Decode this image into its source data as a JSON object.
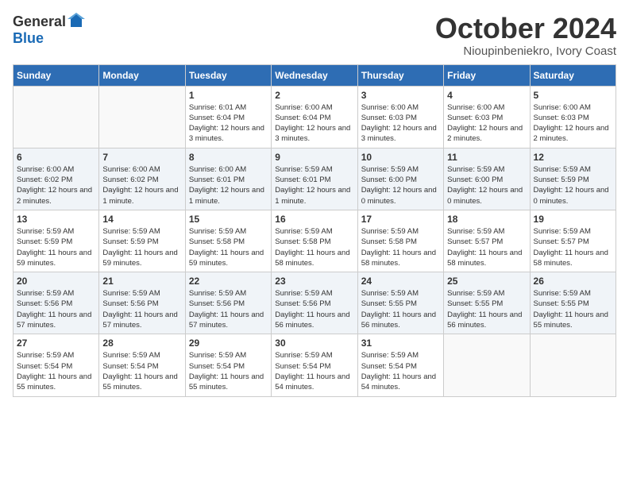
{
  "logo": {
    "general": "General",
    "blue": "Blue"
  },
  "title": "October 2024",
  "location": "Nioupinbeniekro, Ivory Coast",
  "weekdays": [
    "Sunday",
    "Monday",
    "Tuesday",
    "Wednesday",
    "Thursday",
    "Friday",
    "Saturday"
  ],
  "weeks": [
    [
      {
        "day": "",
        "info": ""
      },
      {
        "day": "",
        "info": ""
      },
      {
        "day": "1",
        "info": "Sunrise: 6:01 AM\nSunset: 6:04 PM\nDaylight: 12 hours and 3 minutes."
      },
      {
        "day": "2",
        "info": "Sunrise: 6:00 AM\nSunset: 6:04 PM\nDaylight: 12 hours and 3 minutes."
      },
      {
        "day": "3",
        "info": "Sunrise: 6:00 AM\nSunset: 6:03 PM\nDaylight: 12 hours and 3 minutes."
      },
      {
        "day": "4",
        "info": "Sunrise: 6:00 AM\nSunset: 6:03 PM\nDaylight: 12 hours and 2 minutes."
      },
      {
        "day": "5",
        "info": "Sunrise: 6:00 AM\nSunset: 6:03 PM\nDaylight: 12 hours and 2 minutes."
      }
    ],
    [
      {
        "day": "6",
        "info": "Sunrise: 6:00 AM\nSunset: 6:02 PM\nDaylight: 12 hours and 2 minutes."
      },
      {
        "day": "7",
        "info": "Sunrise: 6:00 AM\nSunset: 6:02 PM\nDaylight: 12 hours and 1 minute."
      },
      {
        "day": "8",
        "info": "Sunrise: 6:00 AM\nSunset: 6:01 PM\nDaylight: 12 hours and 1 minute."
      },
      {
        "day": "9",
        "info": "Sunrise: 5:59 AM\nSunset: 6:01 PM\nDaylight: 12 hours and 1 minute."
      },
      {
        "day": "10",
        "info": "Sunrise: 5:59 AM\nSunset: 6:00 PM\nDaylight: 12 hours and 0 minutes."
      },
      {
        "day": "11",
        "info": "Sunrise: 5:59 AM\nSunset: 6:00 PM\nDaylight: 12 hours and 0 minutes."
      },
      {
        "day": "12",
        "info": "Sunrise: 5:59 AM\nSunset: 5:59 PM\nDaylight: 12 hours and 0 minutes."
      }
    ],
    [
      {
        "day": "13",
        "info": "Sunrise: 5:59 AM\nSunset: 5:59 PM\nDaylight: 11 hours and 59 minutes."
      },
      {
        "day": "14",
        "info": "Sunrise: 5:59 AM\nSunset: 5:59 PM\nDaylight: 11 hours and 59 minutes."
      },
      {
        "day": "15",
        "info": "Sunrise: 5:59 AM\nSunset: 5:58 PM\nDaylight: 11 hours and 59 minutes."
      },
      {
        "day": "16",
        "info": "Sunrise: 5:59 AM\nSunset: 5:58 PM\nDaylight: 11 hours and 58 minutes."
      },
      {
        "day": "17",
        "info": "Sunrise: 5:59 AM\nSunset: 5:58 PM\nDaylight: 11 hours and 58 minutes."
      },
      {
        "day": "18",
        "info": "Sunrise: 5:59 AM\nSunset: 5:57 PM\nDaylight: 11 hours and 58 minutes."
      },
      {
        "day": "19",
        "info": "Sunrise: 5:59 AM\nSunset: 5:57 PM\nDaylight: 11 hours and 58 minutes."
      }
    ],
    [
      {
        "day": "20",
        "info": "Sunrise: 5:59 AM\nSunset: 5:56 PM\nDaylight: 11 hours and 57 minutes."
      },
      {
        "day": "21",
        "info": "Sunrise: 5:59 AM\nSunset: 5:56 PM\nDaylight: 11 hours and 57 minutes."
      },
      {
        "day": "22",
        "info": "Sunrise: 5:59 AM\nSunset: 5:56 PM\nDaylight: 11 hours and 57 minutes."
      },
      {
        "day": "23",
        "info": "Sunrise: 5:59 AM\nSunset: 5:56 PM\nDaylight: 11 hours and 56 minutes."
      },
      {
        "day": "24",
        "info": "Sunrise: 5:59 AM\nSunset: 5:55 PM\nDaylight: 11 hours and 56 minutes."
      },
      {
        "day": "25",
        "info": "Sunrise: 5:59 AM\nSunset: 5:55 PM\nDaylight: 11 hours and 56 minutes."
      },
      {
        "day": "26",
        "info": "Sunrise: 5:59 AM\nSunset: 5:55 PM\nDaylight: 11 hours and 55 minutes."
      }
    ],
    [
      {
        "day": "27",
        "info": "Sunrise: 5:59 AM\nSunset: 5:54 PM\nDaylight: 11 hours and 55 minutes."
      },
      {
        "day": "28",
        "info": "Sunrise: 5:59 AM\nSunset: 5:54 PM\nDaylight: 11 hours and 55 minutes."
      },
      {
        "day": "29",
        "info": "Sunrise: 5:59 AM\nSunset: 5:54 PM\nDaylight: 11 hours and 55 minutes."
      },
      {
        "day": "30",
        "info": "Sunrise: 5:59 AM\nSunset: 5:54 PM\nDaylight: 11 hours and 54 minutes."
      },
      {
        "day": "31",
        "info": "Sunrise: 5:59 AM\nSunset: 5:54 PM\nDaylight: 11 hours and 54 minutes."
      },
      {
        "day": "",
        "info": ""
      },
      {
        "day": "",
        "info": ""
      }
    ]
  ]
}
